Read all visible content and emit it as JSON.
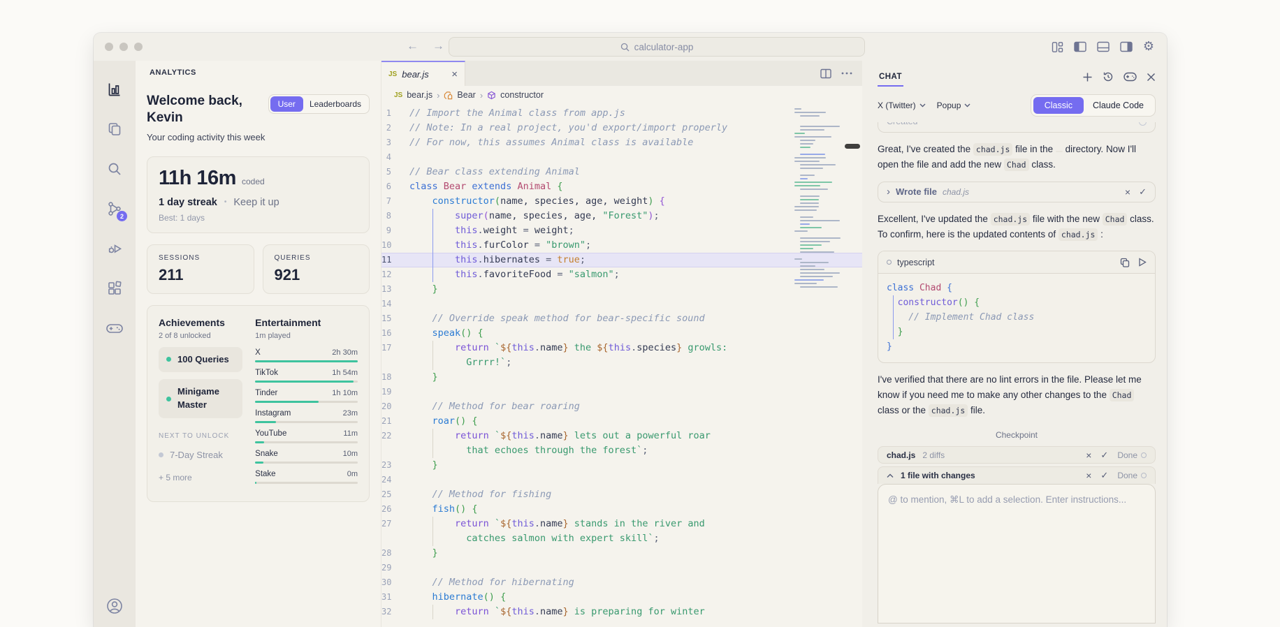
{
  "titlebar": {
    "search_value": "calculator-app",
    "window_controls": [
      "close",
      "minimize",
      "zoom"
    ],
    "nav_icons": [
      "back-arrow-icon",
      "forward-arrow-icon"
    ],
    "right_icons": [
      "layout-grid-icon",
      "panel-left-icon",
      "panel-bottom-icon",
      "panel-right-icon",
      "settings-gear-icon"
    ],
    "gear_glyph": "⚙"
  },
  "activity_bar": {
    "icons": [
      "analytics-bar-chart",
      "files-copy",
      "search",
      "source-control-graph",
      "run-debug",
      "extensions",
      "game-controller"
    ],
    "badge_count": "2",
    "bottom_icon": "account"
  },
  "sidebar": {
    "header": "ANALYTICS",
    "welcome_line1": "Welcome back,",
    "welcome_line2": "Kevin",
    "toggle": {
      "options": [
        "User",
        "Leaderboards"
      ],
      "selected": "User"
    },
    "subtitle": "Your coding activity this week",
    "time_card": {
      "hours": "11h 16m",
      "suffix": "coded",
      "streak": "1 day streak",
      "separator": "•",
      "encourage": "Keep it up",
      "best": "Best: 1 days"
    },
    "stats": [
      {
        "label": "SESSIONS",
        "value": "211"
      },
      {
        "label": "QUERIES",
        "value": "921"
      }
    ],
    "achievements": {
      "title": "Achievements",
      "subtitle": "2 of 8 unlocked",
      "unlocked": [
        "100 Queries",
        "Minigame Master"
      ],
      "next_label": "NEXT TO UNLOCK",
      "locked": [
        "7-Day Streak"
      ],
      "more": "+ 5 more"
    },
    "entertainment": {
      "title": "Entertainment",
      "subtitle": "1m played",
      "rows": [
        {
          "label": "X",
          "value": "2h 30m",
          "pct": 100
        },
        {
          "label": "TikTok",
          "value": "1h 54m",
          "pct": 96
        },
        {
          "label": "Tinder",
          "value": "1h 10m",
          "pct": 62
        },
        {
          "label": "Instagram",
          "value": "23m",
          "pct": 20
        },
        {
          "label": "YouTube",
          "value": "11m",
          "pct": 9
        },
        {
          "label": "Snake",
          "value": "10m",
          "pct": 8
        },
        {
          "label": "Stake",
          "value": "0m",
          "pct": 1
        }
      ]
    }
  },
  "editor": {
    "tab": {
      "icon": "JS",
      "title": "bear.js",
      "close": "×"
    },
    "tab_actions": [
      "split-editor-icon",
      "more-actions-icon"
    ],
    "breadcrumb": [
      {
        "icon": "JS",
        "label": "bear.js"
      },
      {
        "icon": "symbol-class",
        "label": "Bear"
      },
      {
        "icon": "symbol-constructor",
        "label": "constructor"
      }
    ],
    "separator": "›",
    "rows": [
      {
        "n": "1",
        "s": [
          {
            "t": "// Import the Animal class from app.js",
            "c": "cm"
          }
        ]
      },
      {
        "n": "2",
        "s": [
          {
            "t": "// Note: In a real project, you'd export/import properly",
            "c": "cm"
          }
        ]
      },
      {
        "n": "3",
        "s": [
          {
            "t": "// For now, this assumes Animal class is available",
            "c": "cm"
          }
        ]
      },
      {
        "n": "4",
        "s": []
      },
      {
        "n": "5",
        "s": [
          {
            "t": "// Bear class extending Animal",
            "c": "cm"
          }
        ]
      },
      {
        "n": "6",
        "s": [
          {
            "t": "class ",
            "c": "kw"
          },
          {
            "t": "Bear ",
            "c": "cls"
          },
          {
            "t": "extends ",
            "c": "kw"
          },
          {
            "t": "Animal ",
            "c": "cls"
          },
          {
            "t": "{",
            "c": "brG"
          }
        ]
      },
      {
        "n": "7",
        "s": [
          {
            "t": "    "
          },
          {
            "t": "constructor",
            "c": "fn"
          },
          {
            "t": "(",
            "c": "brG"
          },
          {
            "t": "name, species, age, weight",
            "c": "pr"
          },
          {
            "t": ")",
            "c": "brG"
          },
          {
            "t": " "
          },
          {
            "t": "{",
            "c": "brP"
          }
        ]
      },
      {
        "n": "8",
        "g": "blue",
        "s": [
          {
            "t": "        "
          },
          {
            "t": "super",
            "c": "th"
          },
          {
            "t": "(",
            "c": "brP"
          },
          {
            "t": "name, species, age, ",
            "c": "pr"
          },
          {
            "t": "\"Forest\"",
            "c": "str"
          },
          {
            "t": ")",
            "c": "brP"
          },
          {
            "t": ";",
            "c": "pn"
          }
        ]
      },
      {
        "n": "9",
        "g": "blue",
        "s": [
          {
            "t": "        "
          },
          {
            "t": "this",
            "c": "th"
          },
          {
            "t": ".",
            "c": "pn"
          },
          {
            "t": "weight",
            "c": "pr"
          },
          {
            "t": " = ",
            "c": "pn"
          },
          {
            "t": "weight",
            "c": "pr"
          },
          {
            "t": ";",
            "c": "pn"
          }
        ]
      },
      {
        "n": "10",
        "g": "blue",
        "s": [
          {
            "t": "        "
          },
          {
            "t": "this",
            "c": "th"
          },
          {
            "t": ".",
            "c": "pn"
          },
          {
            "t": "furColor",
            "c": "pr"
          },
          {
            "t": " = ",
            "c": "pn"
          },
          {
            "t": "\"brown\"",
            "c": "str"
          },
          {
            "t": ";",
            "c": "pn"
          }
        ]
      },
      {
        "n": "11",
        "hl": true,
        "g": "blue",
        "s": [
          {
            "t": "        "
          },
          {
            "t": "this",
            "c": "th"
          },
          {
            "t": ".",
            "c": "pn"
          },
          {
            "t": "hibernates",
            "c": "pr"
          },
          {
            "t": " = ",
            "c": "pn"
          },
          {
            "t": "true",
            "c": "bool"
          },
          {
            "t": ";",
            "c": "pn"
          }
        ]
      },
      {
        "n": "12",
        "g": "blue",
        "s": [
          {
            "t": "        "
          },
          {
            "t": "this",
            "c": "th"
          },
          {
            "t": ".",
            "c": "pn"
          },
          {
            "t": "favoriteFood",
            "c": "pr"
          },
          {
            "t": " = ",
            "c": "pn"
          },
          {
            "t": "\"salmon\"",
            "c": "str"
          },
          {
            "t": ";",
            "c": "pn"
          }
        ]
      },
      {
        "n": "13",
        "s": [
          {
            "t": "    "
          },
          {
            "t": "}",
            "c": "brG"
          }
        ]
      },
      {
        "n": "14",
        "s": []
      },
      {
        "n": "15",
        "s": [
          {
            "t": "    // Override speak method for bear-specific sound",
            "c": "cm"
          }
        ]
      },
      {
        "n": "16",
        "s": [
          {
            "t": "    "
          },
          {
            "t": "speak",
            "c": "fn"
          },
          {
            "t": "() ",
            "c": "brG"
          },
          {
            "t": "{",
            "c": "brG"
          }
        ]
      },
      {
        "n": "17",
        "g": "gray",
        "s": [
          {
            "t": "        "
          },
          {
            "t": "return ",
            "c": "ctl"
          },
          {
            "t": "`",
            "c": "str"
          },
          {
            "t": "${",
            "c": "tpl"
          },
          {
            "t": "this",
            "c": "th"
          },
          {
            "t": ".",
            "c": "pn"
          },
          {
            "t": "name",
            "c": "pr"
          },
          {
            "t": "}",
            "c": "tpl"
          },
          {
            "t": " the ",
            "c": "str"
          },
          {
            "t": "${",
            "c": "tpl"
          },
          {
            "t": "this",
            "c": "th"
          },
          {
            "t": ".",
            "c": "pn"
          },
          {
            "t": "species",
            "c": "pr"
          },
          {
            "t": "}",
            "c": "tpl"
          },
          {
            "t": " growls:",
            "c": "str"
          }
        ]
      },
      {
        "n": "",
        "g": "gray",
        "s": [
          {
            "t": "          "
          },
          {
            "t": "Grrrr!`",
            "c": "str"
          },
          {
            "t": ";",
            "c": "pn"
          }
        ]
      },
      {
        "n": "18",
        "s": [
          {
            "t": "    "
          },
          {
            "t": "}",
            "c": "brG"
          }
        ]
      },
      {
        "n": "19",
        "s": []
      },
      {
        "n": "20",
        "s": [
          {
            "t": "    // Method for bear roaring",
            "c": "cm"
          }
        ]
      },
      {
        "n": "21",
        "s": [
          {
            "t": "    "
          },
          {
            "t": "roar",
            "c": "fn"
          },
          {
            "t": "() ",
            "c": "brG"
          },
          {
            "t": "{",
            "c": "brG"
          }
        ]
      },
      {
        "n": "22",
        "g": "gray",
        "s": [
          {
            "t": "        "
          },
          {
            "t": "return ",
            "c": "ctl"
          },
          {
            "t": "`",
            "c": "str"
          },
          {
            "t": "${",
            "c": "tpl"
          },
          {
            "t": "this",
            "c": "th"
          },
          {
            "t": ".",
            "c": "pn"
          },
          {
            "t": "name",
            "c": "pr"
          },
          {
            "t": "}",
            "c": "tpl"
          },
          {
            "t": " lets out a powerful roar",
            "c": "str"
          }
        ]
      },
      {
        "n": "",
        "g": "gray",
        "s": [
          {
            "t": "          "
          },
          {
            "t": "that echoes through the forest`",
            "c": "str"
          },
          {
            "t": ";",
            "c": "pn"
          }
        ]
      },
      {
        "n": "23",
        "s": [
          {
            "t": "    "
          },
          {
            "t": "}",
            "c": "brG"
          }
        ]
      },
      {
        "n": "24",
        "s": []
      },
      {
        "n": "25",
        "s": [
          {
            "t": "    // Method for fishing",
            "c": "cm"
          }
        ]
      },
      {
        "n": "26",
        "s": [
          {
            "t": "    "
          },
          {
            "t": "fish",
            "c": "fn"
          },
          {
            "t": "() ",
            "c": "brG"
          },
          {
            "t": "{",
            "c": "brG"
          }
        ]
      },
      {
        "n": "27",
        "g": "gray",
        "s": [
          {
            "t": "        "
          },
          {
            "t": "return ",
            "c": "ctl"
          },
          {
            "t": "`",
            "c": "str"
          },
          {
            "t": "${",
            "c": "tpl"
          },
          {
            "t": "this",
            "c": "th"
          },
          {
            "t": ".",
            "c": "pn"
          },
          {
            "t": "name",
            "c": "pr"
          },
          {
            "t": "}",
            "c": "tpl"
          },
          {
            "t": " stands in the river and",
            "c": "str"
          }
        ]
      },
      {
        "n": "",
        "g": "gray",
        "s": [
          {
            "t": "          "
          },
          {
            "t": "catches salmon with expert skill`",
            "c": "str"
          },
          {
            "t": ";",
            "c": "pn"
          }
        ]
      },
      {
        "n": "28",
        "s": [
          {
            "t": "    "
          },
          {
            "t": "}",
            "c": "brG"
          }
        ]
      },
      {
        "n": "29",
        "s": []
      },
      {
        "n": "30",
        "s": [
          {
            "t": "    // Method for hibernating",
            "c": "cm"
          }
        ]
      },
      {
        "n": "31",
        "s": [
          {
            "t": "    "
          },
          {
            "t": "hibernate",
            "c": "fn"
          },
          {
            "t": "() ",
            "c": "brG"
          },
          {
            "t": "{",
            "c": "brG"
          }
        ]
      },
      {
        "n": "32",
        "g": "gray",
        "s": [
          {
            "t": "        "
          },
          {
            "t": "return ",
            "c": "ctl"
          },
          {
            "t": "`",
            "c": "str"
          },
          {
            "t": "${",
            "c": "tpl"
          },
          {
            "t": "this",
            "c": "th"
          },
          {
            "t": ".",
            "c": "pn"
          },
          {
            "t": "name",
            "c": "pr"
          },
          {
            "t": "}",
            "c": "tpl"
          },
          {
            "t": " is preparing for winter",
            "c": "str"
          }
        ]
      }
    ]
  },
  "chat": {
    "title": "CHAT",
    "header_icons": [
      "new-chat-plus-icon",
      "history-clock-icon",
      "console-pill-icon",
      "close-x-icon"
    ],
    "model_dropdown": "X (Twitter)",
    "mode_dropdown": "Popup",
    "segmented": {
      "options": [
        "Classic",
        "Claude Code"
      ],
      "selected": "Classic"
    },
    "clipped_box_label": "Created",
    "messages": {
      "m1": [
        {
          "t": "Great, I've created the "
        },
        {
          "t": "chad.js",
          "code": true
        },
        {
          "t": " file in the "
        },
        {
          "t": " ",
          "code": true
        },
        {
          "t": " directory. Now I'll open the file and add the new "
        },
        {
          "t": "Chad",
          "code": true
        },
        {
          "t": " class."
        }
      ],
      "m2": [
        {
          "t": "Excellent, I've updated the "
        },
        {
          "t": "chad.js",
          "code": true
        },
        {
          "t": " file with the new "
        },
        {
          "t": "Chad",
          "code": true
        },
        {
          "t": " class. To confirm, here is the updated contents of "
        },
        {
          "t": "chad.js",
          "code": true
        },
        {
          "t": " :"
        }
      ],
      "m3": [
        {
          "t": "I've verified that there are no lint errors in the file. Please let me know if you need me to make any other changes to the "
        },
        {
          "t": "Chad",
          "code": true
        },
        {
          "t": " class or the "
        },
        {
          "t": "chad.js",
          "code": true
        },
        {
          "t": " file."
        }
      ]
    },
    "wrote_file": {
      "chevron": "›",
      "label": "Wrote file",
      "file": "chad.js",
      "close": "×",
      "check": "✓"
    },
    "code_block": {
      "lang": "typescript",
      "rows": [
        {
          "s": [
            {
              "t": "class ",
              "c": "kw"
            },
            {
              "t": "Chad ",
              "c": "cls"
            },
            {
              "t": "{",
              "c": "brB"
            }
          ]
        },
        {
          "g": "blue",
          "s": [
            {
              "t": "  "
            },
            {
              "t": "constructor",
              "c": "th"
            },
            {
              "t": "() ",
              "c": "brG"
            },
            {
              "t": "{",
              "c": "brG"
            }
          ]
        },
        {
          "g": "blue",
          "s": [
            {
              "t": "    // Implement Chad class",
              "c": "cm"
            }
          ]
        },
        {
          "g": "blue",
          "s": [
            {
              "t": "  "
            },
            {
              "t": "}",
              "c": "brG"
            }
          ]
        },
        {
          "s": [
            {
              "t": "}",
              "c": "brB"
            }
          ]
        }
      ]
    },
    "checkpoint_label": "Checkpoint",
    "diff_bars": [
      {
        "file": "chad.js",
        "meta": "2 diffs",
        "close": "×",
        "check": "✓",
        "action": "Done"
      },
      {
        "file": "1 file with changes",
        "meta": "",
        "close": "×",
        "check": "✓",
        "action": "Done"
      }
    ],
    "input_placeholder": "@ to mention, ⌘L to add a selection. Enter instructions..."
  }
}
